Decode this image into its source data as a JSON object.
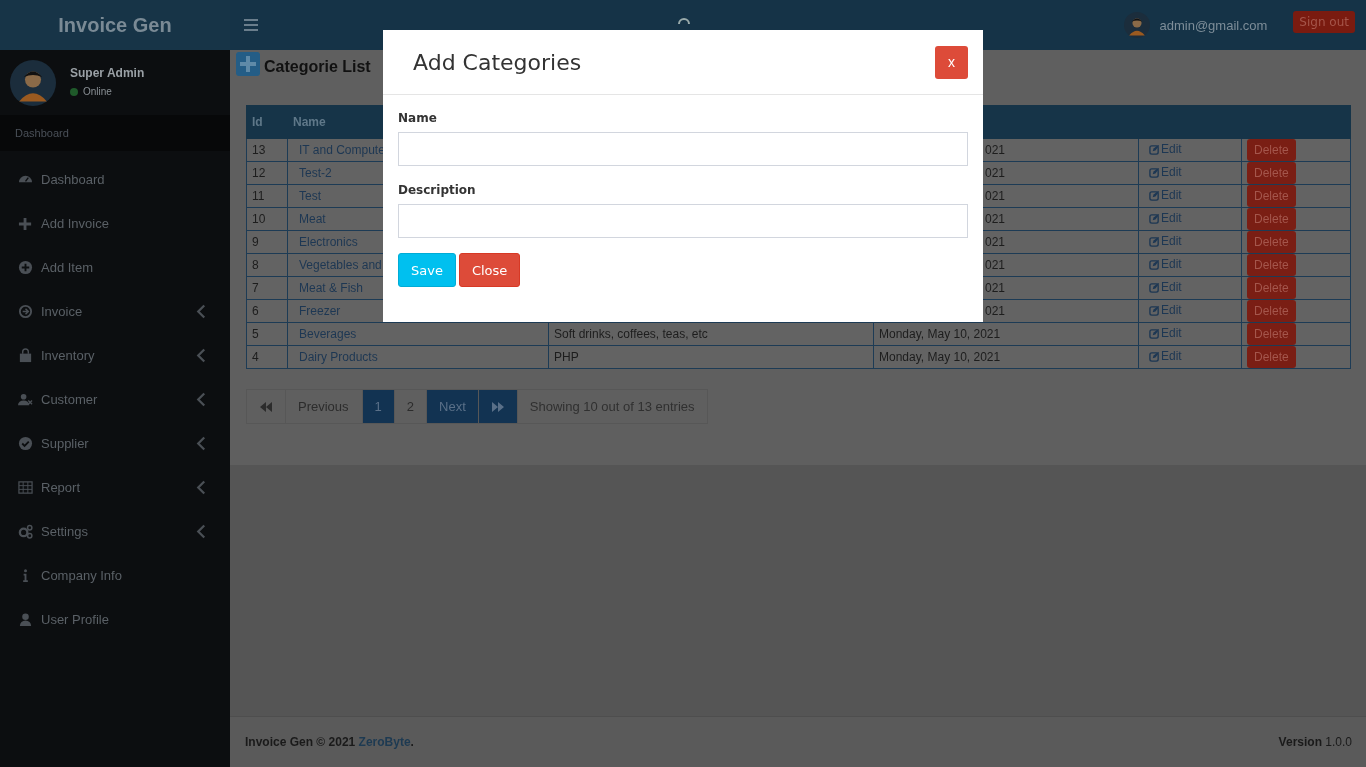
{
  "header": {
    "brand": "Invoice Gen",
    "user_email": "admin@gmail.com",
    "sign_out": "Sign out"
  },
  "sidebar": {
    "user": {
      "name": "Super Admin",
      "status": "Online"
    },
    "section_label": "Dashboard",
    "items": [
      {
        "label": "Dashboard",
        "expandable": false
      },
      {
        "label": "Add Invoice",
        "expandable": false
      },
      {
        "label": "Add Item",
        "expandable": false
      },
      {
        "label": "Invoice",
        "expandable": true
      },
      {
        "label": "Inventory",
        "expandable": true
      },
      {
        "label": "Customer",
        "expandable": true
      },
      {
        "label": "Supplier",
        "expandable": true
      },
      {
        "label": "Report",
        "expandable": true
      },
      {
        "label": "Settings",
        "expandable": true
      },
      {
        "label": "Company Info",
        "expandable": false
      },
      {
        "label": "User Profile",
        "expandable": false
      }
    ]
  },
  "page": {
    "title": "Categorie List"
  },
  "table": {
    "columns": [
      "Id",
      "Name"
    ],
    "rows": [
      {
        "id": "13",
        "name": "IT and Compute",
        "date": "021",
        "covered": true,
        "edit": "Edit",
        "delete": "Delete"
      },
      {
        "id": "12",
        "name": "Test-2",
        "date": "021",
        "covered": true,
        "edit": "Edit",
        "delete": "Delete"
      },
      {
        "id": "11",
        "name": "Test",
        "date": "021",
        "covered": true,
        "edit": "Edit",
        "delete": "Delete"
      },
      {
        "id": "10",
        "name": "Meat",
        "date": "021",
        "covered": true,
        "edit": "Edit",
        "delete": "Delete"
      },
      {
        "id": "9",
        "name": "Electronics",
        "date": "021",
        "covered": true,
        "edit": "Edit",
        "delete": "Delete"
      },
      {
        "id": "8",
        "name": "Vegetables and",
        "date": "021",
        "covered": true,
        "edit": "Edit",
        "delete": "Delete"
      },
      {
        "id": "7",
        "name": "Meat & Fish",
        "date": "021",
        "covered": true,
        "edit": "Edit",
        "delete": "Delete"
      },
      {
        "id": "6",
        "name": "Freezer",
        "date": "021",
        "covered": true,
        "edit": "Edit",
        "delete": "Delete"
      },
      {
        "id": "5",
        "name": "Beverages",
        "description": "Soft drinks, coffees, teas, etc",
        "date": "Monday, May 10, 2021",
        "covered": false,
        "edit": "Edit",
        "delete": "Delete"
      },
      {
        "id": "4",
        "name": "Dairy Products",
        "description": "PHP",
        "date": "Monday, May 10, 2021",
        "covered": false,
        "edit": "Edit",
        "delete": "Delete"
      }
    ]
  },
  "pagination": {
    "previous": {
      "label": "Previous",
      "disabled": true
    },
    "pages": [
      {
        "label": "1",
        "selected": true
      },
      {
        "label": "2",
        "selected": false
      }
    ],
    "next": {
      "label": "Next",
      "disabled": false
    },
    "info": "Showing 10 out of 13 entries"
  },
  "modal": {
    "title": "Add Categories",
    "close_label": "x",
    "fields": [
      {
        "label": "Name"
      },
      {
        "label": "Description"
      }
    ],
    "buttons": [
      {
        "label": "Save",
        "kind": "info"
      },
      {
        "label": "Close",
        "kind": "danger"
      }
    ]
  },
  "footer": {
    "text": "Invoice Gen © 2021 ",
    "link": "ZeroByte",
    "after": ".",
    "version": "**Version** 1.0.0"
  }
}
